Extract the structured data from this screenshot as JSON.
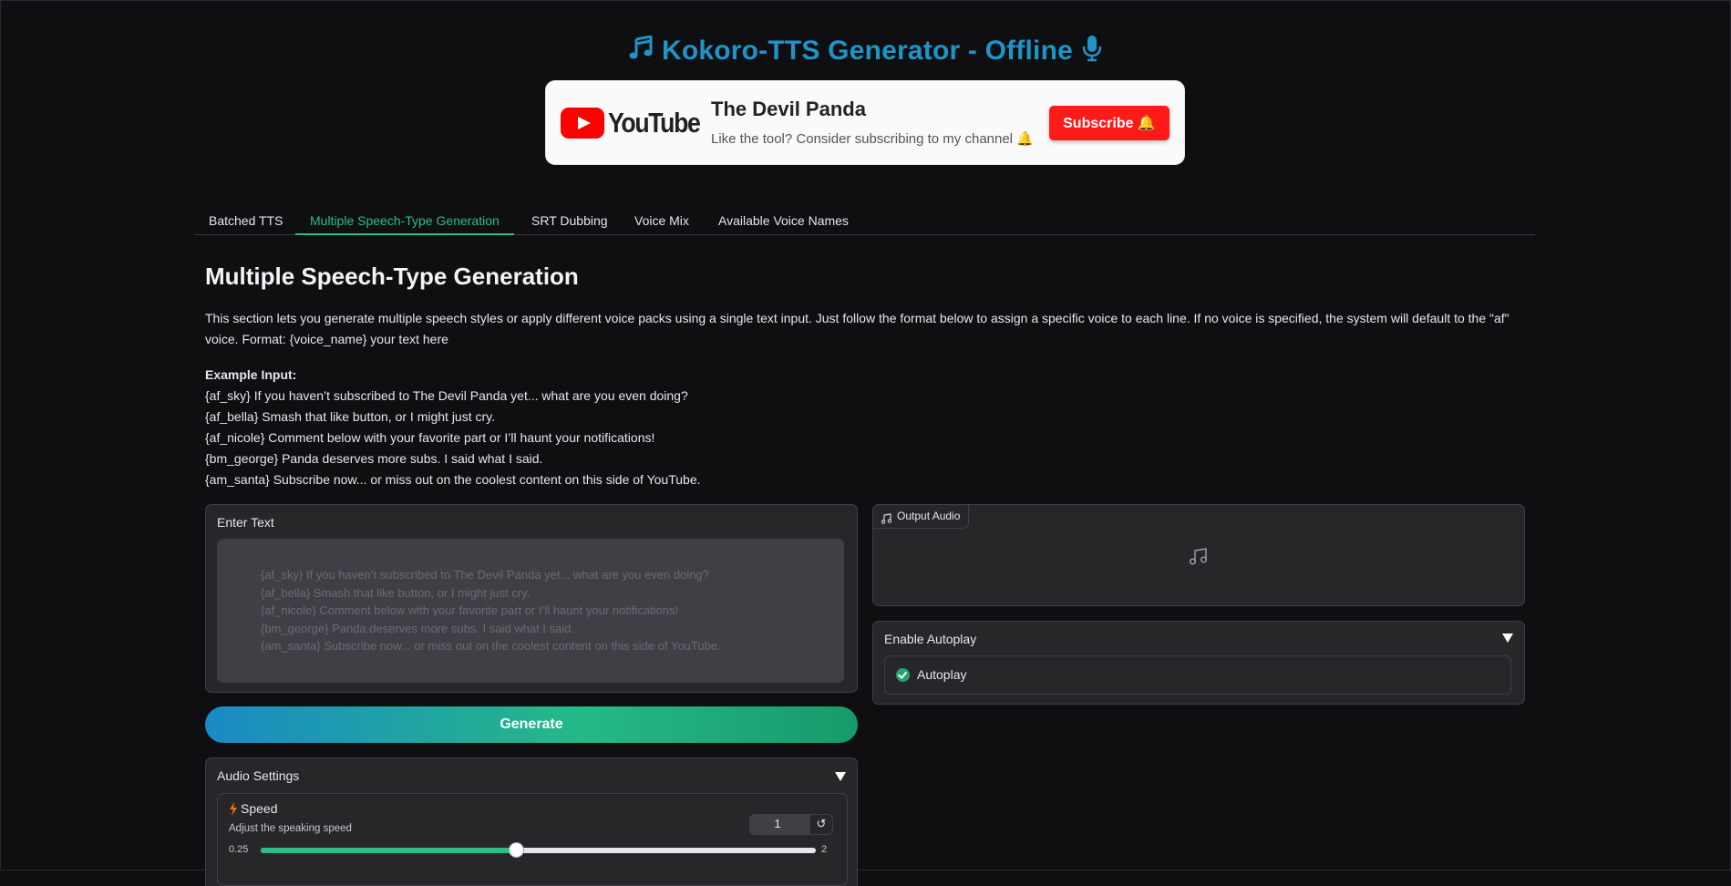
{
  "header": {
    "title": "Kokoro-TTS Generator - Offline",
    "accent_color": "#1e94c7",
    "left_icon": "music-notes-icon",
    "right_icon": "microphone-icon"
  },
  "banner": {
    "logo_text": "YouTube",
    "channel_name": "The Devil Panda",
    "tagline": "Like the tool? Consider subscribing to my channel 🔔",
    "subscribe_label": "Subscribe 🔔",
    "subscribe_color": "#ff1a1a"
  },
  "tabs": [
    {
      "label": "Batched TTS",
      "active": false
    },
    {
      "label": "Multiple Speech-Type Generation",
      "active": true
    },
    {
      "label": "SRT Dubbing",
      "active": false
    },
    {
      "label": "Voice Mix",
      "active": false
    },
    {
      "label": "Available Voice Names",
      "active": false
    }
  ],
  "section": {
    "title": "Multiple Speech-Type Generation",
    "description": "This section lets you generate multiple speech styles or apply different voice packs using a single text input. Just follow the format below to assign a specific voice to each line. If no voice is specified, the system will default to the \"af\" voice. Format: {voice_name} your text here",
    "example_heading": "Example Input:",
    "example_lines": [
      "{af_sky} If you haven’t subscribed to The Devil Panda yet... what are you even doing?",
      "{af_bella} Smash that like button, or I might just cry.",
      "{af_nicole} Comment below with your favorite part or I’ll haunt your notifications!",
      "{bm_george} Panda deserves more subs. I said what I said.",
      "{am_santa} Subscribe now... or miss out on the coolest content on this side of YouTube."
    ]
  },
  "input": {
    "label": "Enter Text",
    "placeholder_lines": [
      "{af_sky} If you haven’t subscribed to The Devil Panda yet... what are you even doing?",
      "{af_bella} Smash that like button, or I might just cry.",
      "{af_nicole} Comment below with your favorite part or I’ll haunt your notifications!",
      "{bm_george} Panda deserves more subs. I said what I said.",
      "{am_santa} Subscribe now... or miss out on the coolest content on this side of YouTube."
    ]
  },
  "generate_label": "Generate",
  "audio_settings": {
    "label": "Audio Settings",
    "speed": {
      "label": "Speed",
      "info": "Adjust the speaking speed",
      "value": "1",
      "reset_icon": "↺",
      "min": "0.25",
      "max": "2",
      "fraction": 0.46
    }
  },
  "output": {
    "label": "Output Audio",
    "icon": "music-note-icon"
  },
  "autoplay": {
    "accordion_label": "Enable Autoplay",
    "checkbox_label": "Autoplay",
    "checked": true
  }
}
